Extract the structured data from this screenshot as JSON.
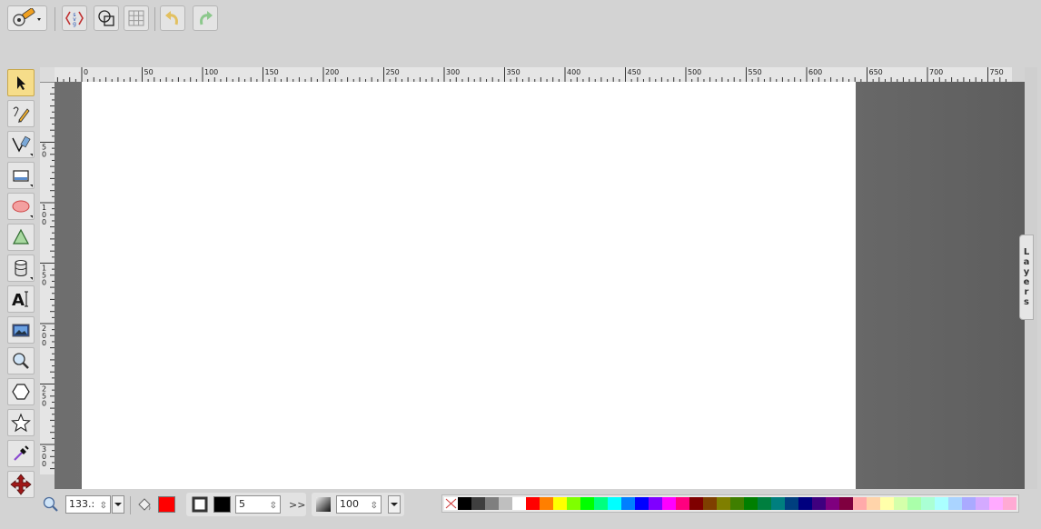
{
  "toolbar": {
    "buttons": [
      {
        "name": "main-menu-button",
        "icon": "logo-pencil-icon"
      },
      {
        "name": "source-editor-button",
        "icon": "svg-source-icon"
      },
      {
        "name": "wireframe-button",
        "icon": "wireframe-icon"
      },
      {
        "name": "grid-button",
        "icon": "grid-icon"
      },
      {
        "name": "undo-button",
        "icon": "undo-icon"
      },
      {
        "name": "redo-button",
        "icon": "redo-icon"
      }
    ]
  },
  "tools": [
    {
      "name": "select-tool",
      "icon": "select-arrow-icon",
      "active": true
    },
    {
      "name": "pencil-tool",
      "icon": "pencil-icon"
    },
    {
      "name": "path-tool",
      "icon": "pen-path-icon"
    },
    {
      "name": "rect-tool",
      "icon": "rectangle-icon"
    },
    {
      "name": "ellipse-tool",
      "icon": "ellipse-icon"
    },
    {
      "name": "shapelib-tool",
      "icon": "triangle-shape-icon"
    },
    {
      "name": "cylinder-tool",
      "icon": "cylinder-icon"
    },
    {
      "name": "text-tool",
      "icon": "text-icon"
    },
    {
      "name": "image-tool",
      "icon": "image-icon"
    },
    {
      "name": "zoom-tool",
      "icon": "magnifier-icon"
    },
    {
      "name": "polygon-tool",
      "icon": "hexagon-icon"
    },
    {
      "name": "star-tool",
      "icon": "star-icon"
    },
    {
      "name": "eyedropper-tool",
      "icon": "eyedropper-icon"
    },
    {
      "name": "pan-tool",
      "icon": "move-arrows-icon"
    }
  ],
  "rulers": {
    "horizontal_labels": [
      "0",
      "50",
      "100",
      "150",
      "200",
      "250",
      "300",
      "350",
      "400",
      "450",
      "500",
      "550",
      "600",
      "650",
      "700",
      "750"
    ],
    "vertical_labels": [
      "5\n0",
      "1\n0\n0",
      "1\n5\n0",
      "2\n0\n0",
      "2\n5\n0",
      "3\n0\n0"
    ]
  },
  "layers_tab": {
    "label_letters": [
      "L",
      "a",
      "y",
      "e",
      "r",
      "s"
    ]
  },
  "bottom": {
    "zoom_value": "133.:",
    "stroke_width": "5",
    "opacity_value": "100",
    "more_label": ">>",
    "fill_color": "#ff0000",
    "stroke_color": "#000000"
  },
  "palette": {
    "colors": [
      "#000000",
      "#3f3f3f",
      "#7f7f7f",
      "#bfbfbf",
      "#ffffff",
      "#ff0000",
      "#ff7f00",
      "#ffff00",
      "#7fff00",
      "#00ff00",
      "#00ff7f",
      "#00ffff",
      "#007fff",
      "#0000ff",
      "#7f00ff",
      "#ff00ff",
      "#ff007f",
      "#7f0000",
      "#7f3f00",
      "#7f7f00",
      "#3f7f00",
      "#007f00",
      "#007f3f",
      "#007f7f",
      "#003f7f",
      "#00007f",
      "#3f007f",
      "#7f007f",
      "#7f003f",
      "#ffaaaa",
      "#ffd4aa",
      "#ffffaa",
      "#d4ffaa",
      "#aaffaa",
      "#aaffd4",
      "#aaffff",
      "#aad4ff",
      "#aaaaff",
      "#d4aaff",
      "#ffaaff",
      "#ffaad4"
    ]
  }
}
